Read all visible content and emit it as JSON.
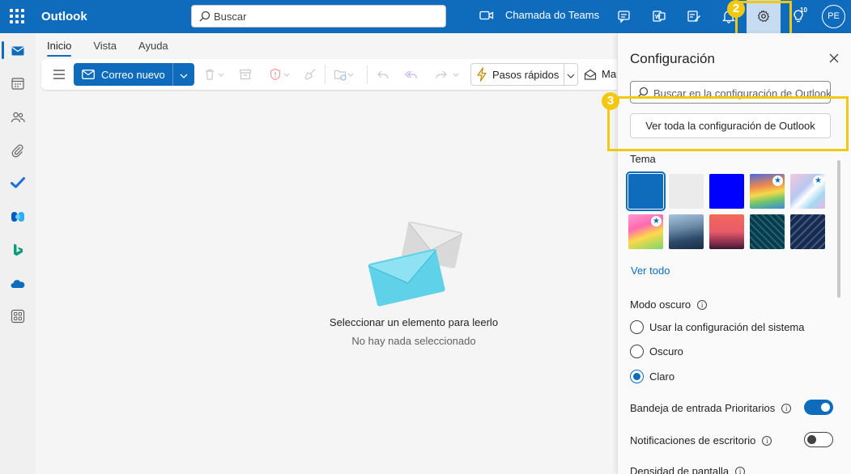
{
  "app": {
    "name": "Outlook"
  },
  "search": {
    "placeholder": "Buscar"
  },
  "header": {
    "teams_call_label": "Chamada do Teams",
    "tips_count": "10",
    "avatar_initials": "PE"
  },
  "annotations": {
    "step2": "2",
    "step3": "3",
    "highlight_color": "#f2c811"
  },
  "ribbon": {
    "tabs": [
      {
        "label": "Inicio",
        "active": true
      },
      {
        "label": "Vista",
        "active": false
      },
      {
        "label": "Ayuda",
        "active": false
      }
    ],
    "new_mail_label": "Correo nuevo",
    "quick_steps_label": "Pasos rápidos",
    "mark_label": "Mar"
  },
  "reading_pane": {
    "empty_title": "Seleccionar un elemento para leerlo",
    "empty_subtitle": "No hay nada seleccionado"
  },
  "settings": {
    "title": "Configuración",
    "search_placeholder": "Buscar en la configuración de Outlook",
    "view_all_label": "Ver toda la configuración de Outlook",
    "theme": {
      "title": "Tema",
      "see_all": "Ver todo",
      "swatches": [
        {
          "name": "blue",
          "selected": true,
          "premium": false
        },
        {
          "name": "light-gray",
          "selected": false,
          "premium": false
        },
        {
          "name": "bright-blue",
          "selected": false,
          "premium": false
        },
        {
          "name": "rainbow-waves",
          "selected": false,
          "premium": true
        },
        {
          "name": "pastel-swirl",
          "selected": false,
          "premium": true
        },
        {
          "name": "unicorn",
          "selected": false,
          "premium": true
        },
        {
          "name": "mountain",
          "selected": false,
          "premium": false
        },
        {
          "name": "palms-sunset",
          "selected": false,
          "premium": false
        },
        {
          "name": "circuit",
          "selected": false,
          "premium": false
        },
        {
          "name": "circuit-dark",
          "selected": false,
          "premium": false
        }
      ]
    },
    "dark_mode": {
      "title": "Modo oscuro",
      "options": [
        {
          "label": "Usar la configuración del sistema",
          "selected": false
        },
        {
          "label": "Oscuro",
          "selected": false
        },
        {
          "label": "Claro",
          "selected": true
        }
      ]
    },
    "focused_inbox": {
      "label": "Bandeja de entrada Prioritarios",
      "on": true
    },
    "desktop_notifications": {
      "label": "Notificaciones de escritorio",
      "on": false
    },
    "density": {
      "label": "Densidad de pantalla"
    }
  },
  "colors": {
    "brand": "#0f6cbd",
    "panel_bg": "#fafafa",
    "app_bg": "#f5f5f5"
  }
}
